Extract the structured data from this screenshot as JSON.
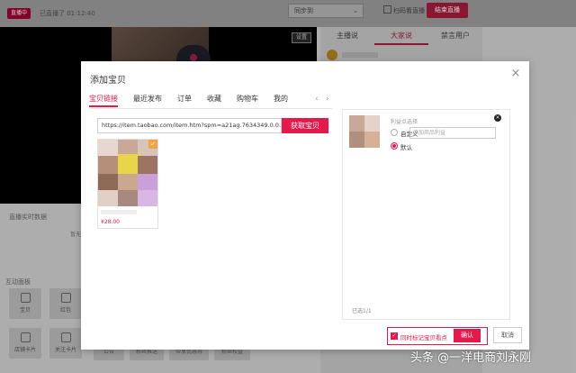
{
  "topbar": {
    "badge": "直播中",
    "status": "已直播了 01:12:40",
    "sync_select": "同步到",
    "scan_label": "扫码看直播",
    "end_button": "结束直播"
  },
  "video": {
    "settings_label": "设置"
  },
  "right_panel": {
    "tabs": [
      "主播说",
      "大家说",
      "禁言用户"
    ],
    "active_tab": 1
  },
  "live_data": {
    "label": "直播实时数据",
    "value_hint": "暂无"
  },
  "interact": {
    "label": "互动面板",
    "tools": [
      "宝贝",
      "红包",
      "店铺卡片",
      "关注卡片",
      "公告",
      "粉丝推送",
      "带享优惠券",
      "粉丝权益"
    ]
  },
  "modal": {
    "title": "添加宝贝",
    "tabs": [
      "宝贝链接",
      "最近发布",
      "订单",
      "收藏",
      "购物车",
      "我的"
    ],
    "active_tab": 0,
    "nav_prev": "‹",
    "nav_next": "›",
    "url_value": "https://item.taobao.com/item.htm?spm=a21ag.7634349.0.0.40f1",
    "fetch_button": "获取宝贝",
    "product": {
      "price": "¥28.00",
      "checked": "✓"
    },
    "selected_panel": {
      "benefit_label": "利益点选择",
      "custom_option": "自定义",
      "default_option": "默认",
      "benefit_placeholder": "添加商品利益",
      "remove": "×",
      "count": "已选1/1"
    },
    "sync_mark": "同时标记宝贝看点",
    "confirm": "确认",
    "cancel": "取消"
  },
  "watermark": "头条 @一洋电商刘永刚",
  "colors": {
    "accent": "#e6194b",
    "end_button": "#a81d3f"
  }
}
